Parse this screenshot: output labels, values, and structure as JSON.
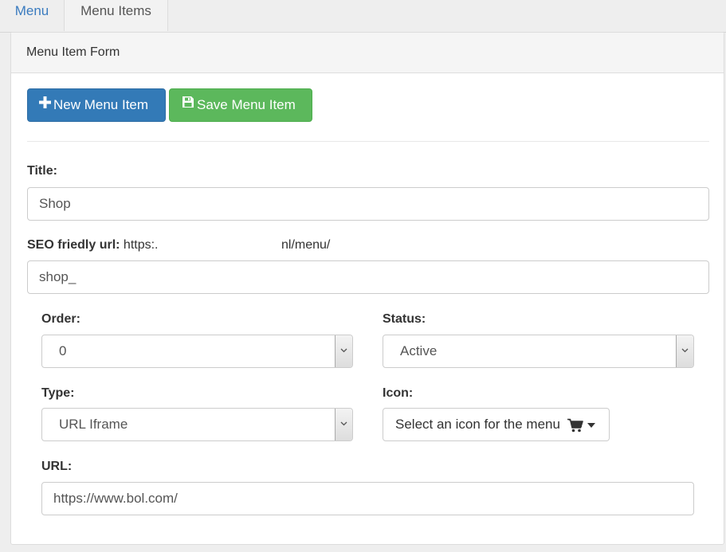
{
  "tabs": [
    {
      "label": "Menu"
    },
    {
      "label": "Menu Items"
    }
  ],
  "panel": {
    "title": "Menu Item Form"
  },
  "toolbar": {
    "new_label": "New Menu Item",
    "save_label": "Save Menu Item"
  },
  "form": {
    "title": {
      "label": "Title:",
      "value": "Shop"
    },
    "seo": {
      "label": "SEO friedly url:",
      "prefix_start": "https:.",
      "prefix_end": "nl/menu/",
      "value": "shop_"
    },
    "order": {
      "label": "Order:",
      "value": "0"
    },
    "status": {
      "label": "Status:",
      "value": "Active"
    },
    "type": {
      "label": "Type:",
      "value": "URL Iframe"
    },
    "icon": {
      "label": "Icon:",
      "button_label": "Select an icon for the menu",
      "selected_icon": "shopping-cart-icon"
    },
    "url": {
      "label": "URL:",
      "value": "https://www.bol.com/"
    }
  },
  "colors": {
    "primary": "#337ab7",
    "success": "#5cb85c",
    "tab_link": "#3a7bbf"
  }
}
